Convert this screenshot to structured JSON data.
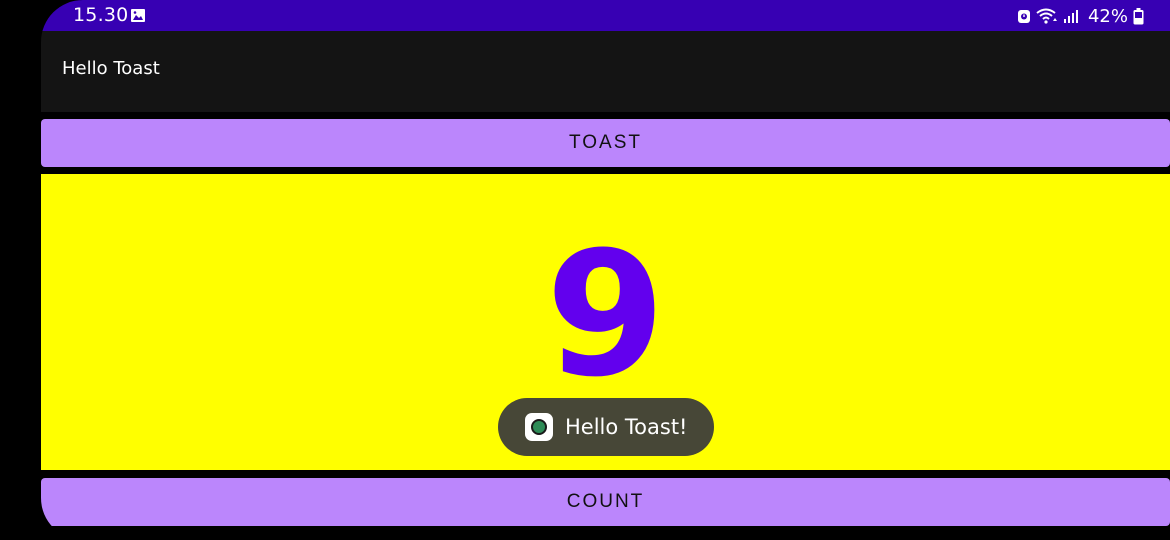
{
  "status_bar": {
    "time": "15.30",
    "battery": "42%",
    "color": "#3700b3"
  },
  "app_bar": {
    "title": "Hello Toast"
  },
  "buttons": {
    "toast_label": "TOAST",
    "count_label": "COUNT",
    "color": "#bb86fc"
  },
  "counter": {
    "value": "9",
    "background": "#ffff00",
    "text_color": "#6200ee"
  },
  "toast": {
    "message": "Hello Toast!",
    "icon": "app-icon"
  },
  "icons": {
    "gallery": "gallery-icon",
    "alarm": "alarm-icon",
    "wifi": "wifi-icon",
    "signal": "signal-icon",
    "battery": "battery-icon"
  }
}
